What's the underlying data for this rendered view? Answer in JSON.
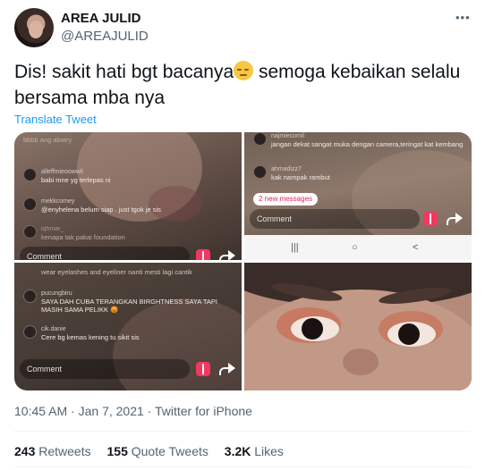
{
  "author": {
    "name": "AREA JULID",
    "handle": "@AREAJULID"
  },
  "more_glyph": "•••",
  "tweet": {
    "text_before_emoji": "Dis! sakit hati bgt bacanya",
    "emoji": "pensive-face",
    "text_after_emoji": " semoga kebaikan selalu bersama mba nya"
  },
  "translate_label": "Translate Tweet",
  "media": {
    "tile1": {
      "comments": [
        {
          "user": "alleffmieoowwil",
          "text": "babi mne yg terlepas ni"
        },
        {
          "user": "mekkcomey",
          "text": "@enyhelena belum siap . just tgok je sis"
        },
        {
          "user": "iqhmar_",
          "text": "kenapa tak pakai foundation"
        }
      ],
      "top_faded": "bbbb ang abatry",
      "comment_placeholder": "Comment"
    },
    "tile2": {
      "comments": [
        {
          "user": "najmiecomil",
          "text": "jangan dekat sangat muka dengan camera,teringat kat kembang"
        },
        {
          "user": "ahmadizz7",
          "text": "kak nampak rambut"
        }
      ],
      "new_messages": "2 new messages",
      "comment_placeholder": "Comment",
      "nav_icons": [
        "|||",
        "○",
        "<"
      ]
    },
    "tile3": {
      "top_faded": "wear eyelashes and eyeliner nanti mesti lagi cantik",
      "comments": [
        {
          "user": "pucungbiru",
          "text": "SAYA DAH CUBA TERANGKAN BIRGHTNESS SAYA TAPI MASIH SAMA PELIKK 😡"
        },
        {
          "user": "cik.danie",
          "text": "Cere bg kemas kening tu sikit sis"
        }
      ],
      "comment_placeholder": "Comment"
    }
  },
  "meta": {
    "time": "10:45 AM",
    "date": "Jan 7, 2021",
    "source": "Twitter for iPhone",
    "separator": " · "
  },
  "stats": {
    "retweets_count": "243",
    "retweets_label": "Retweets",
    "quotes_count": "155",
    "quotes_label": "Quote Tweets",
    "likes_count": "3.2K",
    "likes_label": "Likes"
  }
}
